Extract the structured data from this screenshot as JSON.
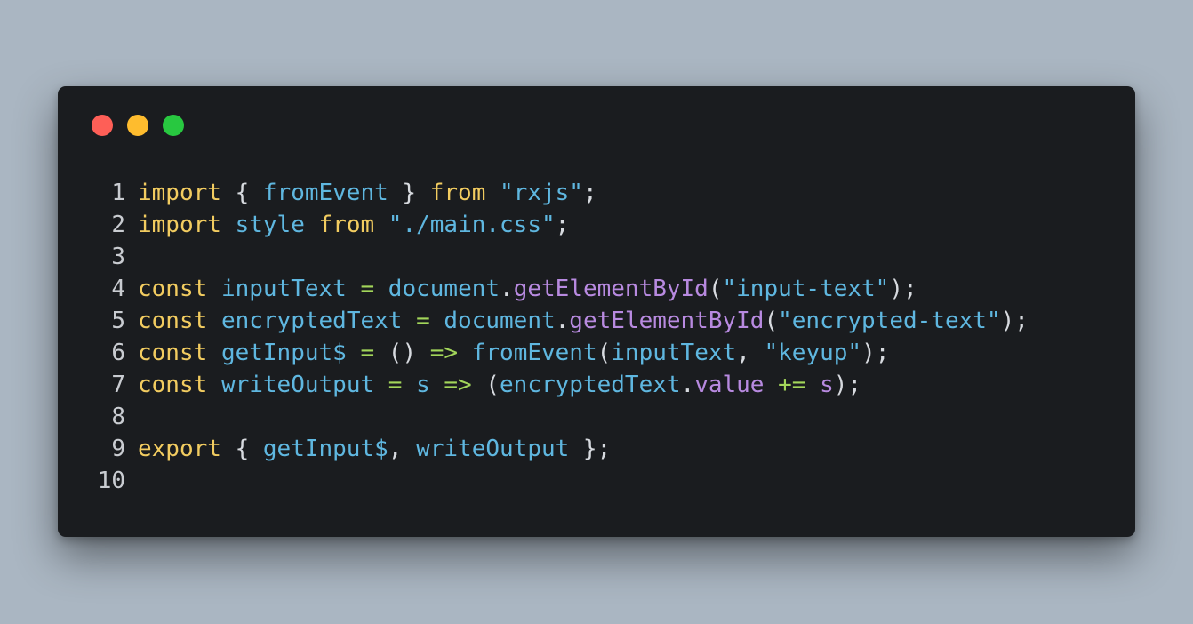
{
  "window": {
    "controls": [
      "close-button",
      "minimize-button",
      "maximize-button"
    ],
    "colors": {
      "background": "#1a1c1f",
      "close": "#fe5f57",
      "minimize": "#febc2e",
      "maximize": "#28c840"
    }
  },
  "code": {
    "language": "javascript",
    "lines": [
      {
        "number": "1",
        "tokens": [
          {
            "t": "import",
            "c": "kw"
          },
          {
            "t": " { ",
            "c": "punc"
          },
          {
            "t": "fromEvent",
            "c": "id"
          },
          {
            "t": " } ",
            "c": "punc"
          },
          {
            "t": "from",
            "c": "kw"
          },
          {
            "t": " ",
            "c": "punc"
          },
          {
            "t": "\"rxjs\"",
            "c": "str"
          },
          {
            "t": ";",
            "c": "punc"
          }
        ]
      },
      {
        "number": "2",
        "tokens": [
          {
            "t": "import",
            "c": "kw"
          },
          {
            "t": " ",
            "c": "punc"
          },
          {
            "t": "style",
            "c": "id"
          },
          {
            "t": " ",
            "c": "punc"
          },
          {
            "t": "from",
            "c": "kw"
          },
          {
            "t": " ",
            "c": "punc"
          },
          {
            "t": "\"./main.css\"",
            "c": "str"
          },
          {
            "t": ";",
            "c": "punc"
          }
        ]
      },
      {
        "number": "3",
        "tokens": []
      },
      {
        "number": "4",
        "tokens": [
          {
            "t": "const",
            "c": "kw"
          },
          {
            "t": " ",
            "c": "punc"
          },
          {
            "t": "inputText",
            "c": "id"
          },
          {
            "t": " ",
            "c": "punc"
          },
          {
            "t": "=",
            "c": "op"
          },
          {
            "t": " ",
            "c": "punc"
          },
          {
            "t": "document",
            "c": "id"
          },
          {
            "t": ".",
            "c": "punc"
          },
          {
            "t": "getElementById",
            "c": "fn"
          },
          {
            "t": "(",
            "c": "punc"
          },
          {
            "t": "\"input-text\"",
            "c": "str"
          },
          {
            "t": ");",
            "c": "punc"
          }
        ]
      },
      {
        "number": "5",
        "tokens": [
          {
            "t": "const",
            "c": "kw"
          },
          {
            "t": " ",
            "c": "punc"
          },
          {
            "t": "encryptedText",
            "c": "id"
          },
          {
            "t": " ",
            "c": "punc"
          },
          {
            "t": "=",
            "c": "op"
          },
          {
            "t": " ",
            "c": "punc"
          },
          {
            "t": "document",
            "c": "id"
          },
          {
            "t": ".",
            "c": "punc"
          },
          {
            "t": "getElementById",
            "c": "fn"
          },
          {
            "t": "(",
            "c": "punc"
          },
          {
            "t": "\"encrypted-text\"",
            "c": "str"
          },
          {
            "t": ");",
            "c": "punc"
          }
        ]
      },
      {
        "number": "6",
        "tokens": [
          {
            "t": "const",
            "c": "kw"
          },
          {
            "t": " ",
            "c": "punc"
          },
          {
            "t": "getInput$",
            "c": "id"
          },
          {
            "t": " ",
            "c": "punc"
          },
          {
            "t": "=",
            "c": "op"
          },
          {
            "t": " () ",
            "c": "punc"
          },
          {
            "t": "=>",
            "c": "op"
          },
          {
            "t": " ",
            "c": "punc"
          },
          {
            "t": "fromEvent",
            "c": "id"
          },
          {
            "t": "(",
            "c": "punc"
          },
          {
            "t": "inputText",
            "c": "id"
          },
          {
            "t": ", ",
            "c": "punc"
          },
          {
            "t": "\"keyup\"",
            "c": "str"
          },
          {
            "t": ");",
            "c": "punc"
          }
        ]
      },
      {
        "number": "7",
        "tokens": [
          {
            "t": "const",
            "c": "kw"
          },
          {
            "t": " ",
            "c": "punc"
          },
          {
            "t": "writeOutput",
            "c": "id"
          },
          {
            "t": " ",
            "c": "punc"
          },
          {
            "t": "=",
            "c": "op"
          },
          {
            "t": " ",
            "c": "punc"
          },
          {
            "t": "s",
            "c": "id"
          },
          {
            "t": " ",
            "c": "punc"
          },
          {
            "t": "=>",
            "c": "op"
          },
          {
            "t": " (",
            "c": "punc"
          },
          {
            "t": "encryptedText",
            "c": "id"
          },
          {
            "t": ".",
            "c": "punc"
          },
          {
            "t": "value",
            "c": "fn"
          },
          {
            "t": " ",
            "c": "punc"
          },
          {
            "t": "+=",
            "c": "op"
          },
          {
            "t": " ",
            "c": "punc"
          },
          {
            "t": "s",
            "c": "fn"
          },
          {
            "t": ");",
            "c": "punc"
          }
        ]
      },
      {
        "number": "8",
        "tokens": []
      },
      {
        "number": "9",
        "tokens": [
          {
            "t": "export",
            "c": "kw"
          },
          {
            "t": " { ",
            "c": "punc"
          },
          {
            "t": "getInput$",
            "c": "id"
          },
          {
            "t": ", ",
            "c": "punc"
          },
          {
            "t": "writeOutput",
            "c": "id"
          },
          {
            "t": " };",
            "c": "punc"
          }
        ]
      },
      {
        "number": "10",
        "tokens": []
      }
    ]
  }
}
